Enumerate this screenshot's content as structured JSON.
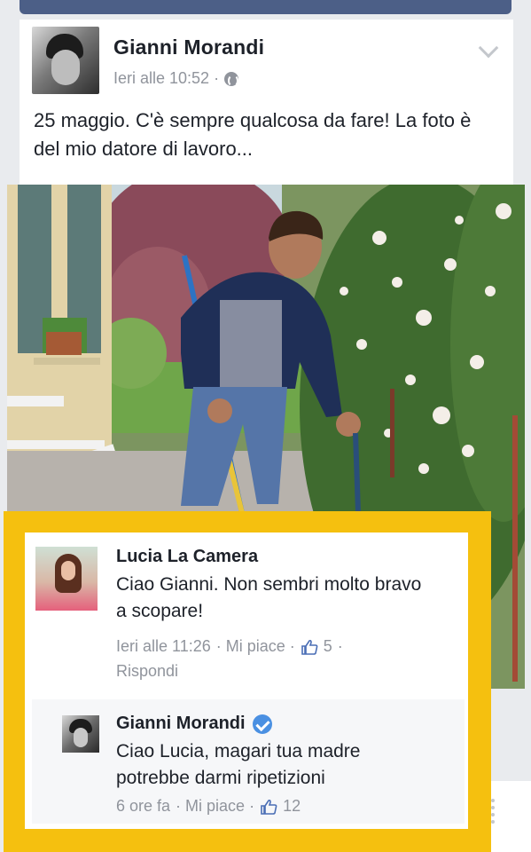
{
  "post": {
    "author": "Gianni Morandi",
    "time": "Ieri alle 10:52 ·",
    "text": "25 maggio. C'è sempre qualcosa da fare! La foto è del mio datore di lavoro..."
  },
  "comments": [
    {
      "author": "Lucia La Camera",
      "text": "Ciao Gianni. Non sembri molto bravo a scopare!",
      "time": "Ieri alle 11:26",
      "like_label": "· Mi piace ·",
      "likes": "5",
      "trail": "·",
      "reply_label": "Rispondi"
    },
    {
      "author": "Gianni Morandi",
      "verified": true,
      "text": "Ciao Lucia, magari tua madre potrebbe darmi ripetizioni",
      "time": "6 ore fa",
      "like_label": "· Mi piace ·",
      "likes": "12"
    }
  ],
  "colors": {
    "highlight_frame": "#f5c00f",
    "verified_badge": "#4a90e2",
    "meta_text": "#90949c",
    "header_strip": "#4c5f87"
  },
  "icons": [
    "globe-icon",
    "chevron-down-icon",
    "thumbs-up-icon",
    "verified-badge-icon"
  ]
}
